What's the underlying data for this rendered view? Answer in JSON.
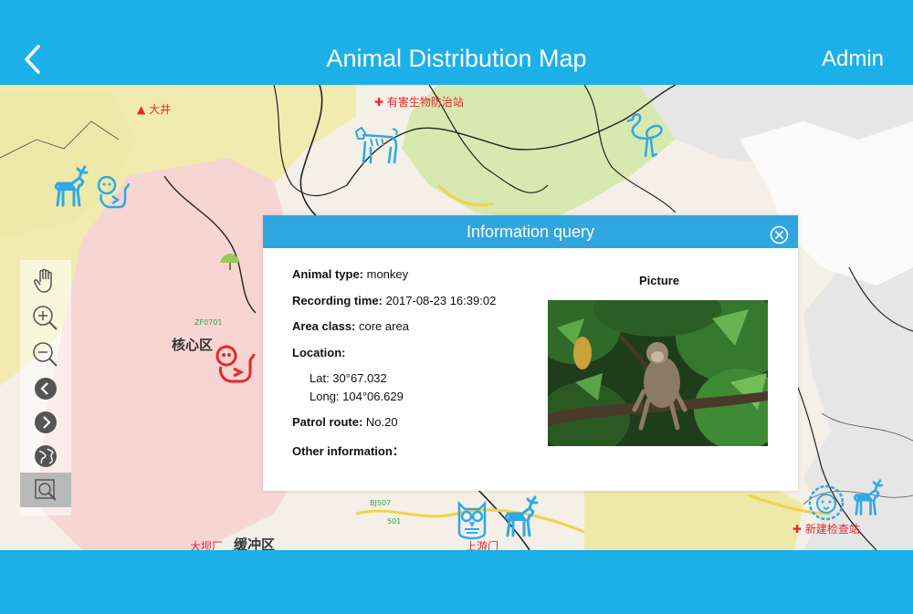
{
  "header": {
    "title": "Animal Distribution Map",
    "user": "Admin"
  },
  "map_labels": {
    "dajing": "大井",
    "pest_station": "有害生物防治站",
    "core_zone": "核心区",
    "buffer_zone": "缓冲区",
    "new_checkpoint": "新建检查站",
    "zf_code": "ZF0701",
    "bj_code": "BJ507",
    "code_501": "501",
    "red_partial": "大坝厂",
    "red_partial_2": "上游门"
  },
  "toolbar": [
    "pan-icon",
    "zoom-in-icon",
    "zoom-out-icon",
    "previous-icon",
    "next-icon",
    "globe-icon",
    "query-icon"
  ],
  "panel": {
    "title": "Information query",
    "animal_type_label": "Animal type:",
    "animal_type_value": " monkey",
    "recording_time_label": "Recording time:",
    "recording_time_value": " 2017-08-23 16:39:02",
    "area_class_label": "Area class:",
    "area_class_value": " core area",
    "location_label": "Location:",
    "lat": "Lat: 30°67.032",
    "long": "Long: 104°06.629",
    "patrol_route_label": "Patrol route:",
    "patrol_route_value": " No.20",
    "other_info_label": "Other information：",
    "picture_label": "Picture"
  },
  "colors": {
    "accent": "#1bb0e8",
    "panel_header": "#2fa6e0",
    "alert_red": "#e8262a",
    "animal_blue": "#2ea9e6"
  }
}
